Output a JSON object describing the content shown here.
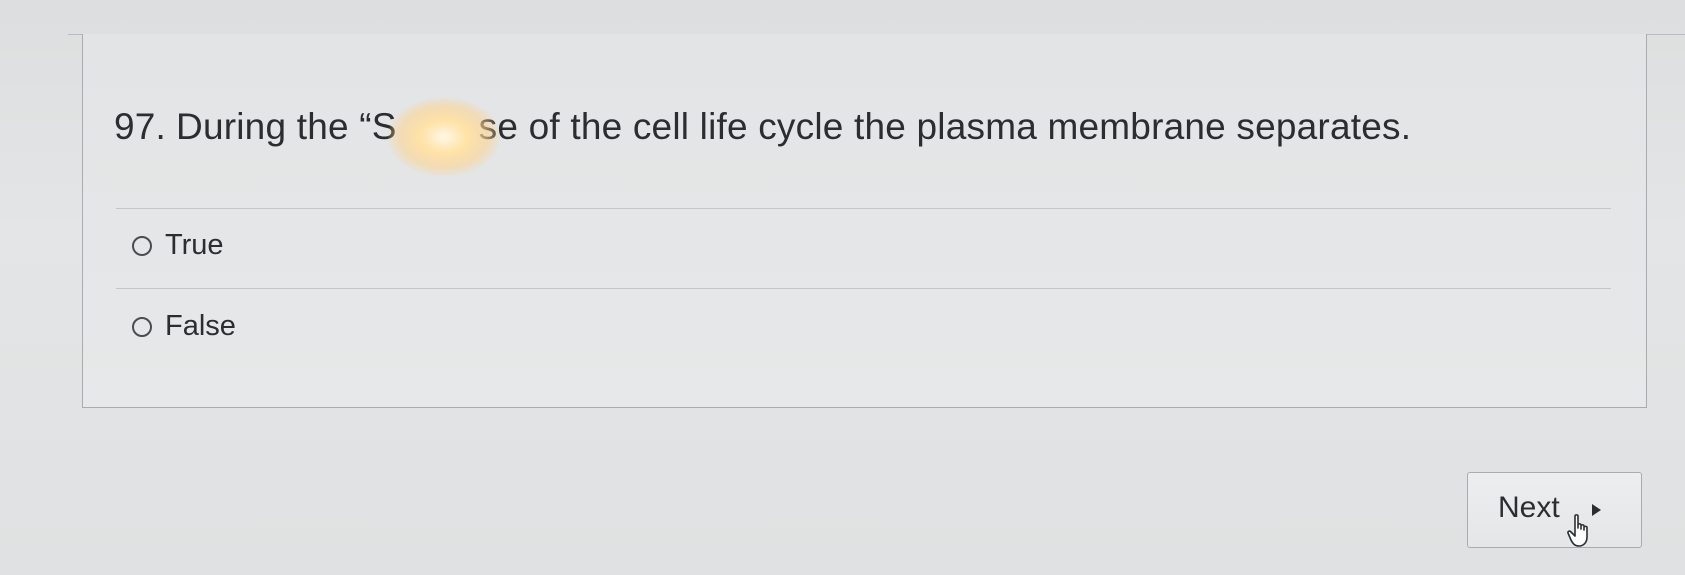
{
  "question": {
    "number": "97.",
    "text_before": "During the “S",
    "text_after": "se of the cell life cycle the plasma membrane separates."
  },
  "options": [
    {
      "label": "True"
    },
    {
      "label": "False"
    }
  ],
  "navigation": {
    "next_label": "Next",
    "next_icon": "play-triangle-icon",
    "cursor_icon": "hand-pointer-icon"
  },
  "colors": {
    "background": "#e2e4e5",
    "text": "#2b2e31",
    "border": "#a9acaf"
  }
}
